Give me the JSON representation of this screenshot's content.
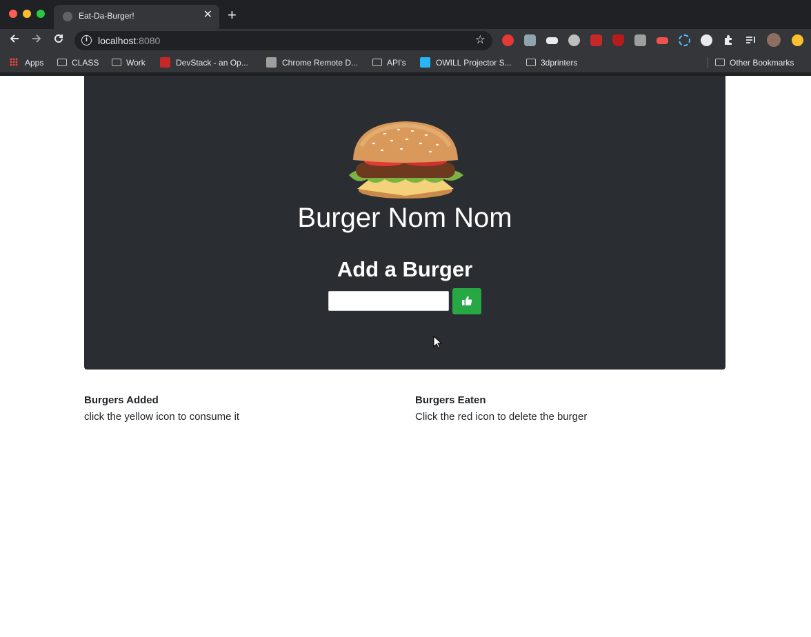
{
  "browser": {
    "tab_title": "Eat-Da-Burger!",
    "tab_close": "✕",
    "new_tab": "+",
    "url_host": "localhost",
    "url_port": ":8080",
    "bookmarks": [
      "Apps",
      "CLASS",
      "Work",
      "DevStack - an Op...",
      "Chrome Remote D...",
      "API's",
      "OWILL Projector S...",
      "3dprinters"
    ],
    "other_bookmarks": "Other Bookmarks"
  },
  "hero": {
    "title": "Burger Nom Nom",
    "add_title": "Add a Burger",
    "input_value": "",
    "submit_icon": "thumbs-up-icon"
  },
  "columns": {
    "added_title": "Burgers Added",
    "added_desc": "click the yellow icon to consume it",
    "eaten_title": "Burgers Eaten",
    "eaten_desc": "Click the red icon to delete the burger"
  },
  "colors": {
    "jumbotron_bg": "#2a2e33",
    "submit_green": "#28a745"
  }
}
